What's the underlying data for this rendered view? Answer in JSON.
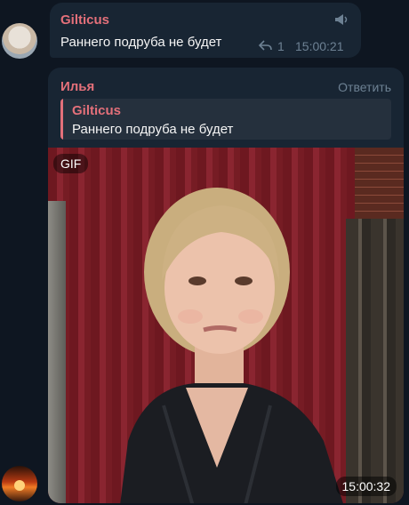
{
  "messages": [
    {
      "sender": "Gilticus",
      "text": "Раннего подруба не будет",
      "reply_count": "1",
      "time": "15:00:21",
      "channel_icon": "megaphone-icon",
      "reply_icon": "reply-arrow-icon"
    },
    {
      "sender": "Илья",
      "reply_action": "Ответить",
      "quote": {
        "sender": "Gilticus",
        "text": "Раннего подруба не будет"
      },
      "media": {
        "badge": "GIF",
        "time": "15:00:32"
      }
    }
  ],
  "colors": {
    "background": "#0e1621",
    "bubble": "#182533",
    "sender_name": "#e4707a",
    "meta": "#6d8193"
  }
}
